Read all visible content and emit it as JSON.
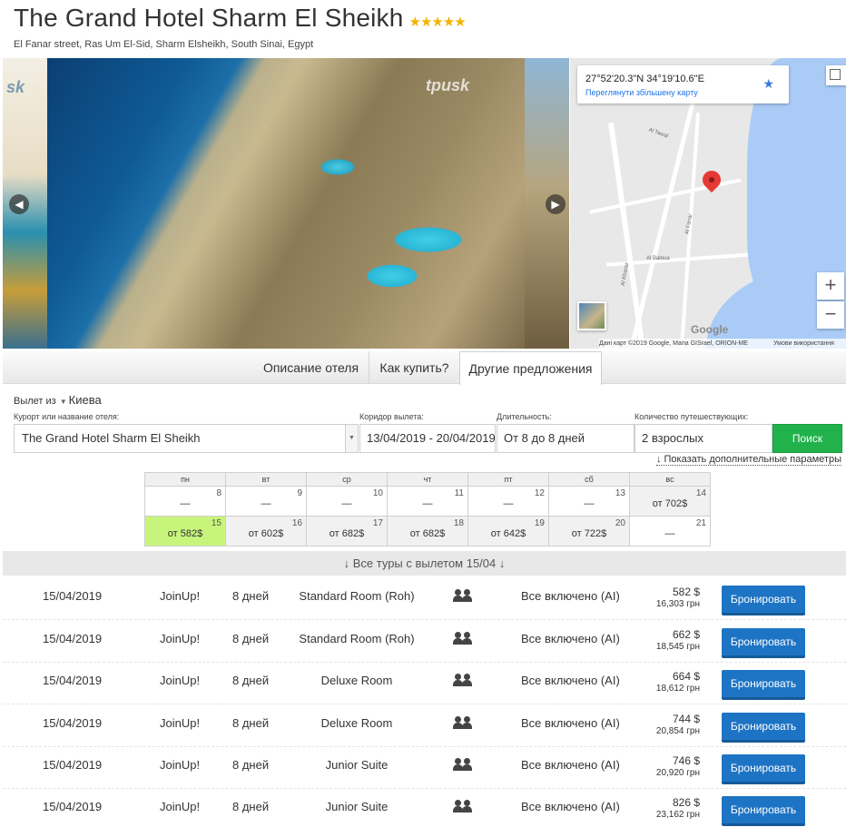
{
  "hotel": {
    "name": "The Grand Hotel Sharm El Sheikh",
    "stars": 5,
    "stars_text": "★★★★★",
    "address": "El Fanar street, Ras Um El-Sid, Sharm Elsheikh, South Sinai, Egypt"
  },
  "gallery": {
    "logo": "tpusk",
    "prev_icon": "chevron-left-icon",
    "next_icon": "chevron-right-icon"
  },
  "map": {
    "coords": "27°52'20.3\"N 34°19'10.6\"E",
    "link": "Переглянути збільшену карту",
    "streets": [
      "Al Tawal",
      "Al Fanar",
      "Al Baloua",
      "Al Kharaz"
    ],
    "google": "Google",
    "attribution": "Дані карт ©2019 Google, Мапа GISrael, ORION-ME",
    "terms": "Умови використання",
    "zoom_in": "+",
    "zoom_out": "−"
  },
  "tabs": [
    "Описание отеля",
    "Как купить?",
    "Другие предложения"
  ],
  "search": {
    "depart_label": "Вылет из",
    "depart_city": "Киева",
    "hotel_label": "Курорт или название отеля:",
    "hotel_value": "The Grand Hotel Sharm El Sheikh",
    "dates_label": "Коридор вылета:",
    "dates_value": "13/04/2019 - 20/04/2019",
    "duration_label": "Длительность:",
    "duration_value": "От 8 до 8 дней",
    "people_label": "Количество путешествующих:",
    "people_value": "2 взрослых",
    "button": "Поиск",
    "more_params": "↓ Показать дополнительные параметры"
  },
  "calendar": {
    "weekdays": [
      "пн",
      "вт",
      "ср",
      "чт",
      "пт",
      "сб",
      "вс"
    ],
    "weeks": [
      [
        {
          "day": "8",
          "price": "—"
        },
        {
          "day": "9",
          "price": "—"
        },
        {
          "day": "10",
          "price": "—"
        },
        {
          "day": "11",
          "price": "—"
        },
        {
          "day": "12",
          "price": "—"
        },
        {
          "day": "13",
          "price": "—"
        },
        {
          "day": "14",
          "price": "от 702$"
        }
      ],
      [
        {
          "day": "15",
          "price": "от 582$"
        },
        {
          "day": "16",
          "price": "от 602$"
        },
        {
          "day": "17",
          "price": "от 682$"
        },
        {
          "day": "18",
          "price": "от 682$"
        },
        {
          "day": "19",
          "price": "от 642$"
        },
        {
          "day": "20",
          "price": "от 722$"
        },
        {
          "day": "21",
          "price": "—"
        }
      ]
    ]
  },
  "all_tours": "↓ Все туры с вылетом 15/04 ↓",
  "tours": [
    {
      "date": "15/04/2019",
      "operator": "JoinUp!",
      "duration": "8 дней",
      "room": "Standard Room (Roh)",
      "meal": "Все включено (AI)",
      "price": "582 $",
      "price_uah": "16,303 грн",
      "book": "Бронировать"
    },
    {
      "date": "15/04/2019",
      "operator": "JoinUp!",
      "duration": "8 дней",
      "room": "Standard Room (Roh)",
      "meal": "Все включено (AI)",
      "price": "662 $",
      "price_uah": "18,545 грн",
      "book": "Бронировать"
    },
    {
      "date": "15/04/2019",
      "operator": "JoinUp!",
      "duration": "8 дней",
      "room": "Deluxe Room",
      "meal": "Все включено (AI)",
      "price": "664 $",
      "price_uah": "18,612 грн",
      "book": "Бронировать"
    },
    {
      "date": "15/04/2019",
      "operator": "JoinUp!",
      "duration": "8 дней",
      "room": "Deluxe Room",
      "meal": "Все включено (AI)",
      "price": "744 $",
      "price_uah": "20,854 грн",
      "book": "Бронировать"
    },
    {
      "date": "15/04/2019",
      "operator": "JoinUp!",
      "duration": "8 дней",
      "room": "Junior Suite",
      "meal": "Все включено (AI)",
      "price": "746 $",
      "price_uah": "20,920 грн",
      "book": "Бронировать"
    },
    {
      "date": "15/04/2019",
      "operator": "JoinUp!",
      "duration": "8 дней",
      "room": "Junior Suite",
      "meal": "Все включено (AI)",
      "price": "826 $",
      "price_uah": "23,162 грн",
      "book": "Бронировать"
    }
  ],
  "colors": {
    "search_button": "#22b24c",
    "book_button": "#1e74c4",
    "selected_day": "#c7f57b",
    "stars": "#f0b400"
  }
}
